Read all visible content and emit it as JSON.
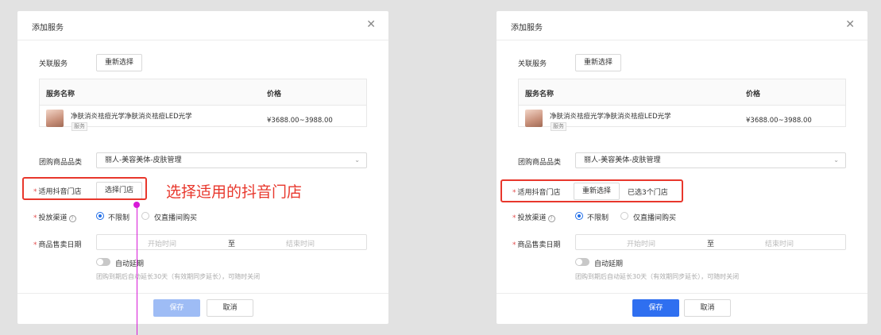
{
  "left": {
    "title": "添加服务",
    "assoc_label": "关联服务",
    "reselect_btn": "重新选择",
    "table": {
      "col_name": "服务名称",
      "col_price": "价格",
      "row": {
        "name": "净肤消炎祛痘光学净肤消炎祛痘LED光学",
        "tag": "服务",
        "price": "¥3688.00~3988.00"
      }
    },
    "category_label": "团购商品品类",
    "category_value": "丽人-美容美体-皮肤管理",
    "store_label": "适用抖音门店",
    "store_btn": "选择门店",
    "channel_label": "投放渠道",
    "channel_opt1": "不限制",
    "channel_opt2": "仅直播间购买",
    "date_label": "商品售卖日期",
    "date_start": "开始时间",
    "date_sep": "至",
    "date_end": "结束时间",
    "auto_extend": "自动延期",
    "hint": "团购到期后自动延长30天（有效期同步延长），可随时关闭",
    "save": "保存",
    "cancel": "取消"
  },
  "right": {
    "title": "添加服务",
    "assoc_label": "关联服务",
    "reselect_btn": "重新选择",
    "table": {
      "col_name": "服务名称",
      "col_price": "价格",
      "row": {
        "name": "净肤消炎祛痘光学净肤消炎祛痘LED光学",
        "tag": "服务",
        "price": "¥3688.00~3988.00"
      }
    },
    "category_label": "团购商品品类",
    "category_value": "丽人-美容美体-皮肤管理",
    "store_label": "适用抖音门店",
    "store_btn": "重新选择",
    "store_selected": "已选3个门店",
    "channel_label": "投放渠道",
    "channel_opt1": "不限制",
    "channel_opt2": "仅直播间购买",
    "date_label": "商品售卖日期",
    "date_start": "开始时间",
    "date_sep": "至",
    "date_end": "结束时间",
    "auto_extend": "自动延期",
    "hint": "团购到期后自动延长30天（有效期同步延长），可随时关闭",
    "save": "保存",
    "cancel": "取消"
  },
  "annotation": {
    "text": "选择适用的抖音门店"
  },
  "colors": {
    "primary": "#2f6ff0",
    "primary_disabled": "#9ebcf5",
    "highlight": "#e8372c",
    "pin": "#d81ad8"
  }
}
